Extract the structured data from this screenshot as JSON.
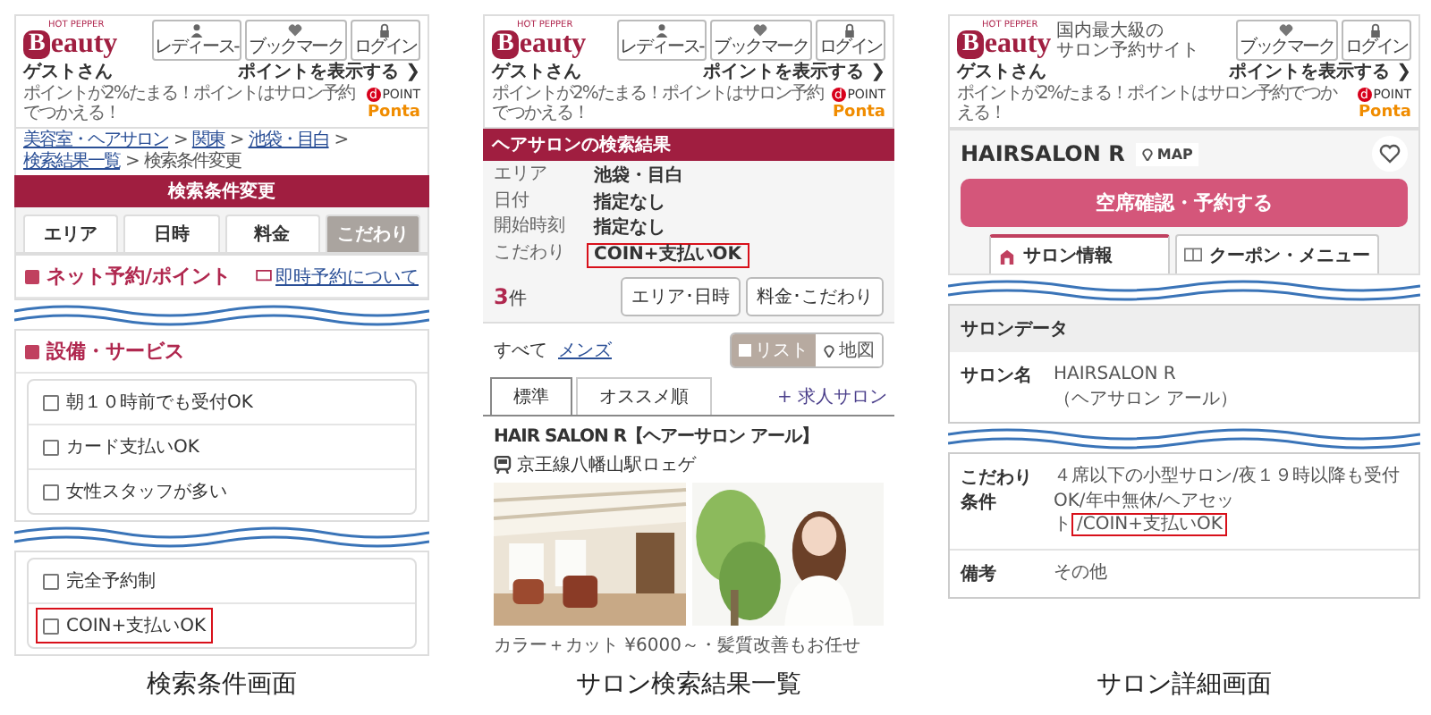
{
  "screens": [
    {
      "kind": "search_conditions",
      "caption": "検索条件画面",
      "header": {
        "brand_small": "HOT PEPPER",
        "logo_initial": "B",
        "logo_rest": "eauty",
        "buttons": [
          {
            "kind": "person",
            "label": "レディース-"
          },
          {
            "kind": "heart",
            "label": "ブックマーク"
          },
          {
            "kind": "lock",
            "label": "ログイン"
          }
        ],
        "guest": "ゲストさん",
        "points_link": "ポイントを表示する ❯",
        "points_note": "ポイントが2%たまる！ポイントはサロン予約でつかえる！",
        "partners": [
          {
            "kind": "dpoint",
            "mark": "d",
            "name": "POINT"
          },
          {
            "kind": "ponta",
            "name": "Ponta"
          }
        ]
      },
      "breadcrumb": [
        "美容室・ヘアサロン",
        "関東",
        "池袋・目白",
        "検索結果一覧",
        "検索条件変更"
      ],
      "breadcrumb_separator": ">",
      "title_bar": "検索条件変更",
      "tabs": [
        {
          "label": "エリア",
          "selected": false
        },
        {
          "label": "日時",
          "selected": false
        },
        {
          "label": "料金",
          "selected": false
        },
        {
          "label": "こだわり",
          "selected": true
        }
      ],
      "sections": [
        {
          "title": "ネット予約/ポイント",
          "link": "即時予約について"
        },
        {
          "title": "設備・サービス",
          "options": [
            {
              "label": "朝１０時前でも受付OK",
              "checked": false,
              "highlighted": false
            },
            {
              "label": "カード支払いOK",
              "checked": false,
              "highlighted": false
            },
            {
              "label": "女性スタッフが多い",
              "checked": false,
              "highlighted": false
            }
          ]
        },
        {
          "options": [
            {
              "label": "完全予約制",
              "checked": false,
              "highlighted": false
            },
            {
              "label": "COIN+支払いOK",
              "checked": false,
              "highlighted": true
            }
          ]
        }
      ]
    },
    {
      "kind": "search_results",
      "caption": "サロン検索結果一覧",
      "header": {
        "brand_small": "HOT PEPPER",
        "logo_initial": "B",
        "logo_rest": "eauty",
        "buttons": [
          {
            "kind": "person",
            "label": "レディース-"
          },
          {
            "kind": "heart",
            "label": "ブックマーク"
          },
          {
            "kind": "lock",
            "label": "ログイン"
          }
        ],
        "guest": "ゲストさん",
        "points_link": "ポイントを表示する ❯",
        "points_note": "ポイントが2%たまる！ポイントはサロン予約でつかえる！",
        "partners": [
          {
            "kind": "dpoint",
            "mark": "d",
            "name": "POINT"
          },
          {
            "kind": "ponta",
            "name": "Ponta"
          }
        ]
      },
      "title_bar": "ヘアサロンの検索結果",
      "conditions": [
        {
          "label": "エリア",
          "value": "池袋・目白",
          "highlighted": false
        },
        {
          "label": "日付",
          "value": "指定なし",
          "highlighted": false
        },
        {
          "label": "開始時刻",
          "value": "指定なし",
          "highlighted": false
        },
        {
          "label": "こだわり",
          "value": "COIN+支払いOK",
          "highlighted": true
        }
      ],
      "count": "3",
      "count_unit": "件",
      "filter_buttons": [
        "エリア･日時",
        "料金･こだわり"
      ],
      "gender_tabs": [
        {
          "label": "すべて",
          "selected": true
        },
        {
          "label": "メンズ",
          "selected": false
        }
      ],
      "view_toggle": [
        {
          "kind": "list",
          "label": "リスト",
          "selected": true
        },
        {
          "kind": "pin",
          "label": "地図",
          "selected": false
        }
      ],
      "sort_tabs": [
        {
          "label": "標準",
          "selected": true
        },
        {
          "label": "オススメ順",
          "selected": false
        }
      ],
      "job_link": "+ 求人サロン",
      "salon": {
        "name": "HAIR SALON R【ヘアーサロン アール】",
        "station": "京王線八幡山駅ロェゲ",
        "catch": "カラー＋カット ¥6000～・髪質改善もお任せ"
      }
    },
    {
      "kind": "salon_detail",
      "caption": "サロン詳細画面",
      "header": {
        "brand_small": "HOT PEPPER",
        "logo_initial": "B",
        "logo_rest": "eauty",
        "tagline": [
          "国内最大級の",
          "サロン予約サイト"
        ],
        "buttons": [
          {
            "kind": "heart",
            "label": "ブックマーク"
          },
          {
            "kind": "lock",
            "label": "ログイン"
          }
        ],
        "guest": "ゲストさん",
        "points_link": "ポイントを表示する ❯",
        "points_note": "ポイントが2%たまる！ポイントはサロン予約でつかえる！",
        "partners": [
          {
            "kind": "dpoint",
            "mark": "d",
            "name": "POINT"
          },
          {
            "kind": "ponta",
            "name": "Ponta"
          }
        ]
      },
      "salon_name": "HAIRSALON R",
      "map_button": "MAP",
      "reserve_button": "空席確認・予約する",
      "tabs": [
        {
          "kind": "home",
          "label": "サロン情報",
          "selected": true
        },
        {
          "kind": "book",
          "label": "クーポン・メニュー",
          "selected": false
        }
      ],
      "sections": [
        {
          "heading": "サロンデータ",
          "rows": [
            {
              "label": "サロン名",
              "lines": [
                "HAIRSALON R",
                "（ヘアサロン アール）"
              ]
            }
          ]
        },
        {
          "rows": [
            {
              "label": "こだわり条件",
              "parts": [
                {
                  "text": "４席以下の小型サロン/夜１９時以降も受付OK/年中無休/ヘアセット",
                  "highlighted": false
                },
                {
                  "text": "/COIN+支払いOK",
                  "highlighted": true
                }
              ]
            },
            {
              "label": "備考",
              "parts": [
                {
                  "text": "その他",
                  "highlighted": false
                }
              ]
            }
          ]
        }
      ]
    }
  ]
}
